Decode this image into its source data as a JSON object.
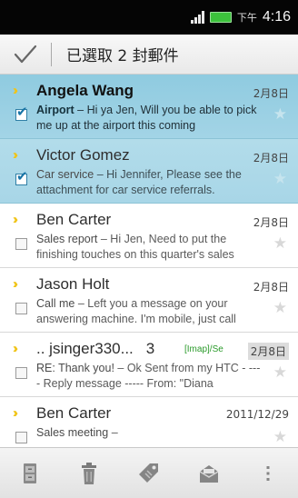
{
  "status_bar": {
    "time_prefix": "下午",
    "time": "4:16",
    "icons": [
      "signal-icon",
      "battery-icon"
    ],
    "battery_color": "#3cc23c"
  },
  "action_bar": {
    "done_icon": "checkmark-icon",
    "title": "已選取 2 封郵件"
  },
  "accent": {
    "selected_row": "#a8d6e7",
    "flag": "#f0c419",
    "folder_tag": "#2a9a2a"
  },
  "mails": [
    {
      "sender": "Angela Wang",
      "date": "2月8日",
      "subject": "Airport",
      "snippet": " – Hi ya Jen, Will you be able to pick me up at the airport this coming",
      "selected": true,
      "checked": true,
      "unread": true,
      "flagged": true
    },
    {
      "sender": "Victor Gomez",
      "date": "2月8日",
      "subject": "Car service",
      "snippet": " – Hi Jennifer, Please see the attachment for car service referrals.",
      "selected": true,
      "checked": true,
      "unread": false,
      "flagged": true
    },
    {
      "sender": "Ben Carter",
      "date": "2月8日",
      "subject": "Sales report",
      "snippet": " – Hi Jen, Need to put the finishing touches on this quarter's sales",
      "selected": false,
      "checked": false,
      "unread": false,
      "flagged": true
    },
    {
      "sender": "Jason Holt",
      "date": "2月8日",
      "subject": "Call me",
      "snippet": " – Left you a message on your answering machine. I'm mobile, just call",
      "selected": false,
      "checked": false,
      "unread": false,
      "flagged": true
    },
    {
      "sender": ".. jsinger330...",
      "count": "3",
      "folder": "[Imap]/Se",
      "date": "2月8日",
      "subject": "RE: Thank you!",
      "snippet": " – Ok Sent from my HTC - ---- Reply message ----- From: \"Diana",
      "selected": false,
      "checked": false,
      "unread": false,
      "flagged": true
    },
    {
      "sender": "Ben Carter",
      "date": "2011/12/29",
      "subject": "Sales meeting",
      "snippet": " –",
      "selected": false,
      "checked": false,
      "unread": false,
      "flagged": true
    }
  ],
  "toolbar": {
    "buttons": [
      {
        "name": "move-to-folder-button",
        "icon": "folder-cabinet-icon"
      },
      {
        "name": "delete-button",
        "icon": "trash-icon"
      },
      {
        "name": "label-button",
        "icon": "tag-icon"
      },
      {
        "name": "mark-read-button",
        "icon": "open-envelope-icon"
      },
      {
        "name": "more-button",
        "icon": "overflow-menu-icon"
      }
    ]
  }
}
